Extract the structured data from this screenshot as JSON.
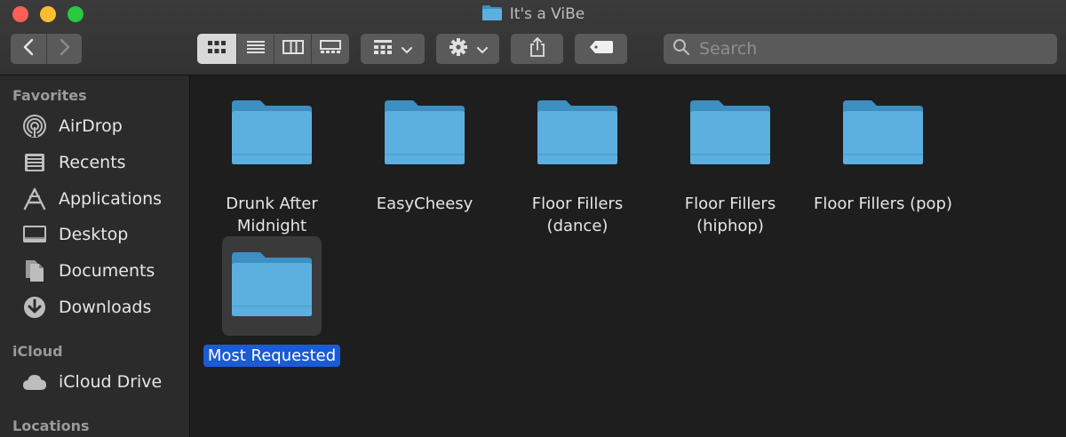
{
  "window": {
    "title": "It's a ViBe"
  },
  "toolbar": {
    "search_placeholder": "Search"
  },
  "sidebar": {
    "sections": [
      {
        "title": "Favorites",
        "items": [
          {
            "label": "AirDrop",
            "icon": "airdrop-icon"
          },
          {
            "label": "Recents",
            "icon": "recents-icon"
          },
          {
            "label": "Applications",
            "icon": "applications-icon"
          },
          {
            "label": "Desktop",
            "icon": "desktop-icon"
          },
          {
            "label": "Documents",
            "icon": "documents-icon"
          },
          {
            "label": "Downloads",
            "icon": "downloads-icon"
          }
        ]
      },
      {
        "title": "iCloud",
        "items": [
          {
            "label": "iCloud Drive",
            "icon": "icloud-icon"
          }
        ]
      },
      {
        "title": "Locations",
        "items": []
      }
    ]
  },
  "main": {
    "folders": [
      {
        "line1": "Drunk After",
        "line2": "Midnight",
        "selected": false
      },
      {
        "line1": "EasyCheesy",
        "line2": "",
        "selected": false
      },
      {
        "line1": "Floor Fillers",
        "line2": "(dance)",
        "selected": false
      },
      {
        "line1": "Floor Fillers",
        "line2": "(hiphop)",
        "selected": false
      },
      {
        "line1": "Floor Fillers (pop)",
        "line2": "",
        "selected": false
      },
      {
        "line1": "Most Requested",
        "line2": "",
        "selected": true
      }
    ]
  },
  "colors": {
    "folder_top": "#5cb0e0",
    "folder_tab": "#3d8fc2",
    "selection": "#1a5bd6"
  }
}
